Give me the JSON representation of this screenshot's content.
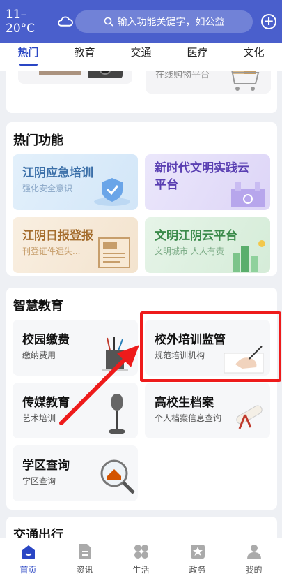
{
  "header": {
    "weather": "11–20°C",
    "search_placeholder": "输入功能关键字，如公益"
  },
  "tabs": [
    {
      "label": "热门",
      "active": true
    },
    {
      "label": "教育"
    },
    {
      "label": "交通"
    },
    {
      "label": "医疗"
    },
    {
      "label": "文化"
    }
  ],
  "top_card": {
    "right_subtitle": "在线购物平台"
  },
  "hot_functions": {
    "title": "热门功能",
    "items": [
      {
        "title": "江阴应急培训",
        "subtitle": "强化安全意识"
      },
      {
        "title": "新时代文明实践云平台",
        "subtitle": ""
      },
      {
        "title": "江阴日报登报",
        "subtitle": "刊登证件遗失..."
      },
      {
        "title": "文明江阴云平台",
        "subtitle": "文明城市 人人有责"
      }
    ]
  },
  "smart_education": {
    "title": "智慧教育",
    "items": [
      {
        "title": "校园缴费",
        "subtitle": "缴纳费用"
      },
      {
        "title": "校外培训监管",
        "subtitle": "规范培训机构"
      },
      {
        "title": "传媒教育",
        "subtitle": "艺术培训"
      },
      {
        "title": "高校生档案",
        "subtitle": "个人档案信息查询"
      },
      {
        "title": "学区查询",
        "subtitle": "学区查询"
      }
    ]
  },
  "traffic": {
    "title": "交通出行"
  },
  "bottom_nav": [
    {
      "label": "首页",
      "active": true
    },
    {
      "label": "资讯"
    },
    {
      "label": "生活"
    },
    {
      "label": "政务"
    },
    {
      "label": "我的"
    }
  ],
  "colors": {
    "brand": "#4a5fcc",
    "accent": "#2a46c4",
    "highlight": "#ee1b1b"
  }
}
